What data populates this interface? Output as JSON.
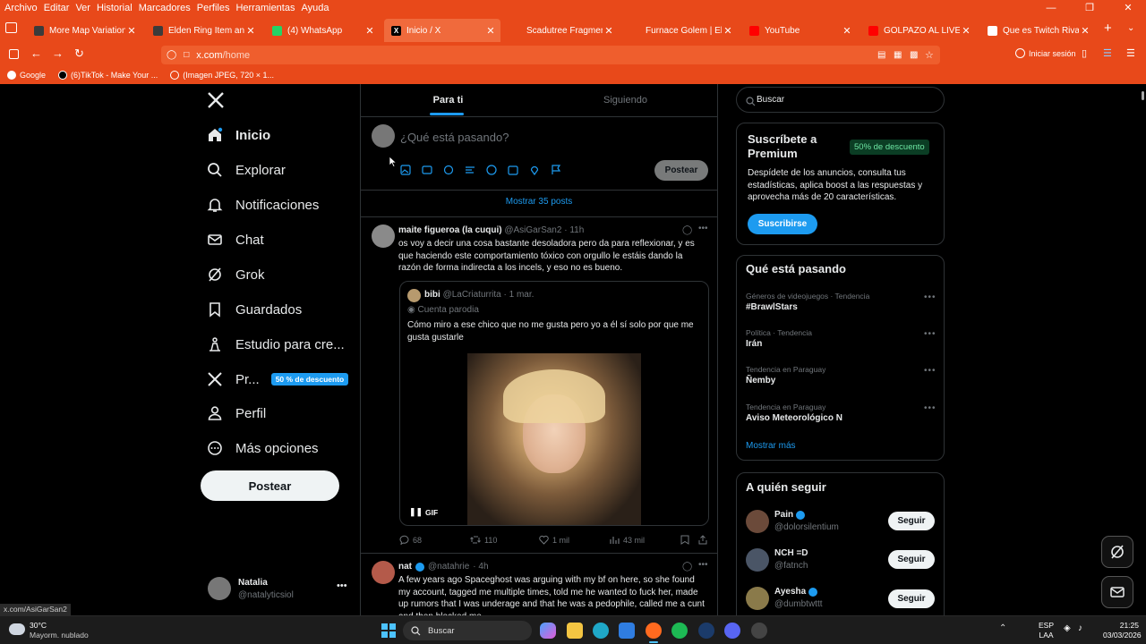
{
  "browser": {
    "menu": [
      "Archivo",
      "Editar",
      "Ver",
      "Historial",
      "Marcadores",
      "Perfiles",
      "Herramientas",
      "Ayuda"
    ],
    "tabs": [
      {
        "title": "More Map Variations at El",
        "color": "#3b3b3b"
      },
      {
        "title": "Elden Ring Item and Enem",
        "color": "#3b3b3b"
      },
      {
        "title": "(4) WhatsApp",
        "color": "#25d366"
      },
      {
        "title": "Inicio / X",
        "color": "#000000"
      },
      {
        "title": "Scadutree Fragment | Elde",
        "color": "#e8491a"
      },
      {
        "title": "Furnace Golem | Elden Rin",
        "color": "#e8491a"
      },
      {
        "title": "YouTube",
        "color": "#ff0000"
      },
      {
        "title": "GOLPAZO AL LIVERPOOL",
        "color": "#ff0000"
      },
      {
        "title": "Que es Twitch Rivals - Goo",
        "color": "#ffffff"
      }
    ],
    "url_host": "x.com",
    "url_path": "/home",
    "signin_label": "Iniciar sesión",
    "bookmarks": [
      "Google",
      "(6)TikTok - Make Your ...",
      "(Imagen JPEG, 720 × 1..."
    ],
    "status_url": "x.com/AsiGarSan2"
  },
  "sidebar": {
    "items": [
      {
        "label": "Inicio",
        "icon": "home-icon"
      },
      {
        "label": "Explorar",
        "icon": "search-icon"
      },
      {
        "label": "Notificaciones",
        "icon": "bell-icon"
      },
      {
        "label": "Chat",
        "icon": "mail-icon"
      },
      {
        "label": "Grok",
        "icon": "grok-icon"
      },
      {
        "label": "Guardados",
        "icon": "bookmark-icon"
      },
      {
        "label": "Estudio para cre...",
        "icon": "creator-icon"
      },
      {
        "label": "Pr...",
        "icon": "x-logo-icon"
      },
      {
        "label": "Perfil",
        "icon": "person-icon"
      },
      {
        "label": "Más opciones",
        "icon": "more-icon"
      }
    ],
    "premium_badge": "50 % de descuento",
    "post_button": "Postear",
    "account": {
      "name": "Natalia",
      "handle": "@natalyticsiol"
    }
  },
  "feed": {
    "tabs": [
      "Para ti",
      "Siguiendo"
    ],
    "composer_placeholder": "¿Qué está pasando?",
    "composer_button": "Postear",
    "show_posts": "Mostrar 35 posts",
    "tweet1": {
      "name": "maite figueroa (la cuqui)",
      "handle": "@AsiGarSan2",
      "time": "· 11h",
      "text": "os voy a decir una cosa bastante desoladora pero da para reflexionar, y es que haciendo este comportamiento tóxico con orgullo le estáis dando la razón de forma indirecta a los incels, y eso no es bueno.",
      "quote": {
        "name": "bibi",
        "handle": "@LaCriaturrita",
        "time": "· 1 mar.",
        "parody": "Cuenta parodia",
        "text": "Cómo miro a ese chico que no me gusta pero yo a él sí solo por que me gusta gustarle",
        "media_badge": "GIF"
      },
      "replies": "68",
      "reposts": "110",
      "likes": "1 mil",
      "views": "43 mil"
    },
    "tweet2": {
      "name": "nat",
      "handle": "@natahrie",
      "time": "· 4h",
      "text": "A few years ago Spaceghost was arguing with my bf on here, so she found my account, tagged me multiple times, told me he wanted to fuck her, made up rumors that I was underage and that he was a pedophile, called me a cunt and then blocked me."
    }
  },
  "right": {
    "search_placeholder": "Buscar",
    "premium": {
      "title": "Suscríbete a Premium",
      "badge": "50% de descuento",
      "text": "Despídete de los anuncios, consulta tus estadísticas, aplica boost a las respuestas y aprovecha más de 20 características.",
      "button": "Suscribirse"
    },
    "trends_title": "Qué está pasando",
    "trends": [
      {
        "meta": "Géneros de videojuegos · Tendencia",
        "name": "#BrawlStars"
      },
      {
        "meta": "Política · Tendencia",
        "name": "Irán"
      },
      {
        "meta": "Tendencia en Paraguay",
        "name": "Ñemby"
      },
      {
        "meta": "Tendencia en Paraguay",
        "name": "Aviso Meteorológico N"
      }
    ],
    "show_more": "Mostrar más",
    "who_title": "A quién seguir",
    "who": [
      {
        "name": "Pain",
        "handle": "@dolorsilentium",
        "verified": true
      },
      {
        "name": "NCH =D",
        "handle": "@fatnch",
        "verified": false
      },
      {
        "name": "Ayesha",
        "handle": "@dumbtwttt",
        "verified": true
      }
    ],
    "follow_label": "Seguir"
  },
  "taskbar": {
    "weather_temp": "30°C",
    "weather_desc": "Mayorm. nublado",
    "search": "Buscar",
    "lang1": "ESP",
    "lang2": "LAA",
    "time": "21:25",
    "date": "03/03/2026"
  }
}
